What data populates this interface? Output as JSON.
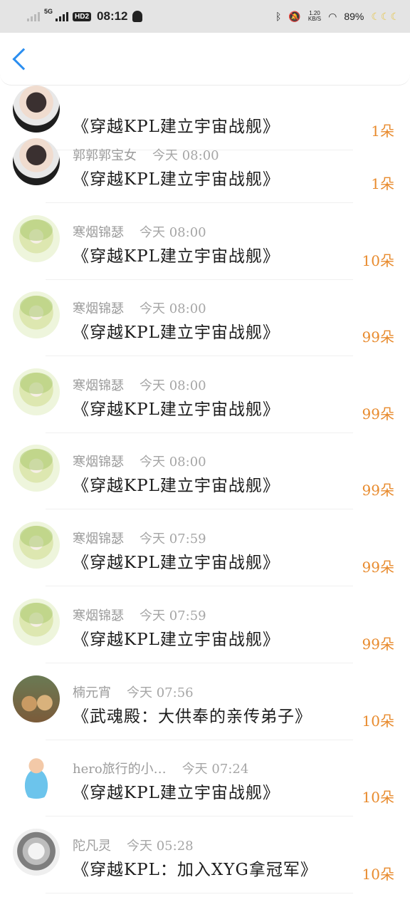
{
  "status_bar": {
    "network": "5G",
    "hd_badge": "HD2",
    "time": "08:12",
    "speed_value": "1.20",
    "speed_unit": "KB/S",
    "battery": "89%",
    "icons": [
      "signal-icon",
      "bluetooth-icon",
      "mute-icon",
      "wifi-icon",
      "moon-icon"
    ]
  },
  "header": {
    "back_icon": "chevron-left-icon",
    "accent_color": "#2b8ef0"
  },
  "colors": {
    "amount": "#e88a2c",
    "meta": "#9b9b9b"
  },
  "records": [
    {
      "avatar": "boy",
      "name": "",
      "time": "",
      "title": "《穿越KPL建立宇宙战舰》",
      "amount": "1朵"
    },
    {
      "avatar": "boy",
      "name": "郭郭郭宝女",
      "time": "今天 08:00",
      "title": "《穿越KPL建立宇宙战舰》",
      "amount": "1朵"
    },
    {
      "avatar": "girl",
      "name": "寒烟锦瑟",
      "time": "今天 08:00",
      "title": "《穿越KPL建立宇宙战舰》",
      "amount": "10朵"
    },
    {
      "avatar": "girl",
      "name": "寒烟锦瑟",
      "time": "今天 08:00",
      "title": "《穿越KPL建立宇宙战舰》",
      "amount": "99朵"
    },
    {
      "avatar": "girl",
      "name": "寒烟锦瑟",
      "time": "今天 08:00",
      "title": "《穿越KPL建立宇宙战舰》",
      "amount": "99朵"
    },
    {
      "avatar": "girl",
      "name": "寒烟锦瑟",
      "time": "今天 08:00",
      "title": "《穿越KPL建立宇宙战舰》",
      "amount": "99朵"
    },
    {
      "avatar": "girl",
      "name": "寒烟锦瑟",
      "time": "今天 07:59",
      "title": "《穿越KPL建立宇宙战舰》",
      "amount": "99朵"
    },
    {
      "avatar": "girl",
      "name": "寒烟锦瑟",
      "time": "今天 07:59",
      "title": "《穿越KPL建立宇宙战舰》",
      "amount": "99朵"
    },
    {
      "avatar": "dogs",
      "name": "楠元宵",
      "time": "今天 07:56",
      "title": "《武魂殿：大供奉的亲传弟子》",
      "amount": "10朵"
    },
    {
      "avatar": "kid",
      "name": "hero旅行的小…",
      "time": "今天 07:24",
      "title": "《穿越KPL建立宇宙战舰》",
      "amount": "10朵"
    },
    {
      "avatar": "anime",
      "name": "陀凡灵",
      "time": "今天 05:28",
      "title": "《穿越KPL：加入XYG拿冠军》",
      "amount": "10朵"
    }
  ]
}
